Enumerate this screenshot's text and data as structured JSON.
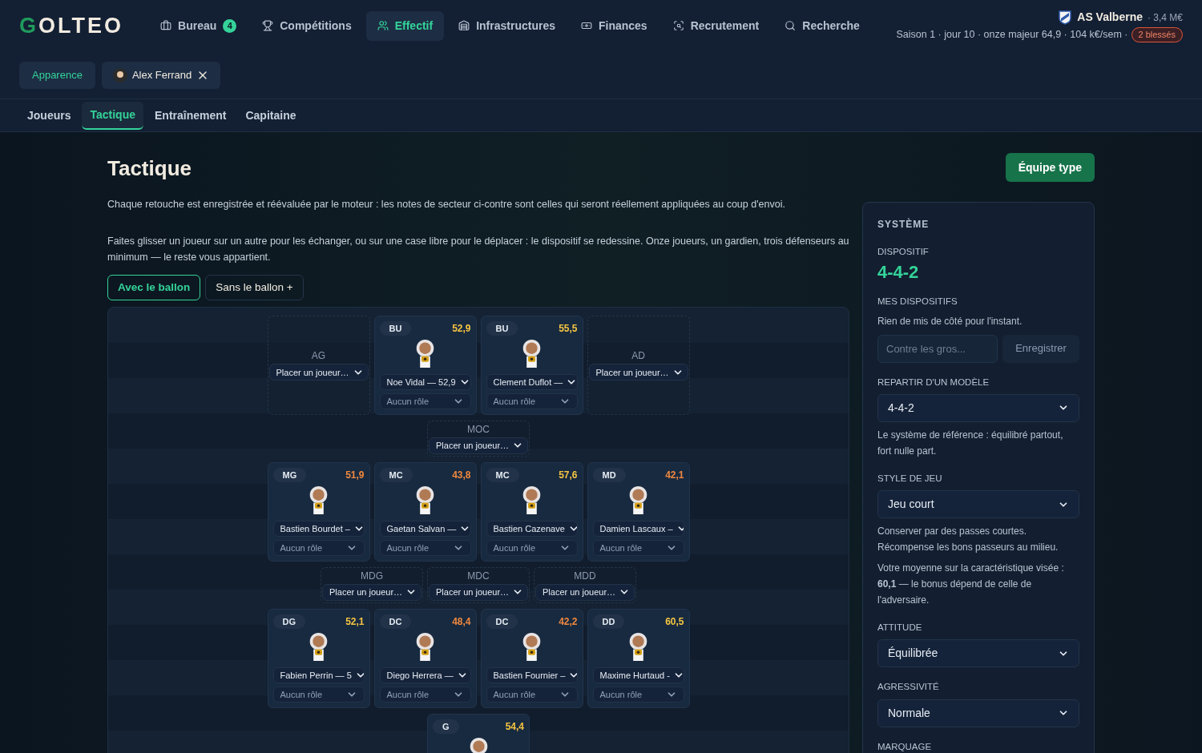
{
  "header": {
    "logo": {
      "accent": "G",
      "rest": "OLTEO"
    },
    "nav": [
      {
        "label": "Bureau",
        "badge": "4",
        "selected": false
      },
      {
        "label": "Compétitions",
        "selected": false
      },
      {
        "label": "Effectif",
        "selected": true
      },
      {
        "label": "Infrastructures",
        "selected": false
      },
      {
        "label": "Finances",
        "selected": false
      },
      {
        "label": "Recrutement",
        "selected": false
      },
      {
        "label": "Recherche",
        "selected": false
      }
    ],
    "club": {
      "name": "AS Valberne",
      "budget": "· 3,4 M€"
    },
    "status": "Saison 1 · jour 10 · onze majeur 64,9 · 104 k€/sem ·",
    "injuries": "2 blessés"
  },
  "chips": [
    {
      "kind": "link",
      "label": "Apparence"
    },
    {
      "kind": "manager",
      "label": "Alex Ferrand"
    }
  ],
  "subtabs": [
    {
      "label": "Joueurs",
      "selected": false
    },
    {
      "label": "Tactique",
      "selected": true
    },
    {
      "label": "Entraînement",
      "selected": false
    },
    {
      "label": "Capitaine",
      "selected": false
    }
  ],
  "page": {
    "title": "Tactique",
    "action": "Équipe type",
    "intro": "Chaque retouche est enregistrée et réévaluée par le moteur : les notes de secteur ci-contre sont celles qui seront réellement appliquées au coup d'envoi.",
    "help": "Faites glisser un joueur sur un autre pour les échanger, ou sur une case libre pour le déplacer : le dispositif se redessine. Onze joueurs, un gardien, trois défenseurs au minimum — le reste vous appartient.",
    "phases": [
      {
        "label": "Avec le ballon",
        "selected": true
      },
      {
        "label": "Sans le ballon +",
        "selected": false
      }
    ]
  },
  "pitch": {
    "rows": [
      {
        "slots": [
          {
            "kind": "empty",
            "label": "AG",
            "value": "Placer un joueur…"
          },
          {
            "kind": "player",
            "position": "BU",
            "rating": "52,9",
            "color": "#f5c542",
            "name": "Noe Vidal — 52,9",
            "role": "Aucun rôle"
          },
          {
            "kind": "player",
            "position": "BU",
            "rating": "55,5",
            "color": "#f5c542",
            "name": "Clement Duflot —",
            "role": "Aucun rôle"
          },
          {
            "kind": "empty",
            "label": "AD",
            "value": "Placer un joueur…"
          }
        ]
      },
      {
        "slots": [
          {
            "kind": "empty",
            "label": "MOC",
            "value": "Placer un joueur…"
          }
        ]
      },
      {
        "slots": [
          {
            "kind": "player",
            "position": "MG",
            "rating": "51,9",
            "color": "#f0883e",
            "name": "Bastien Bourdet –",
            "role": "Aucun rôle"
          },
          {
            "kind": "player",
            "position": "MC",
            "rating": "43,8",
            "color": "#f0883e",
            "name": "Gaetan Salvan —",
            "role": "Aucun rôle"
          },
          {
            "kind": "player",
            "position": "MC",
            "rating": "57,6",
            "color": "#f5c542",
            "name": "Bastien Cazenave",
            "role": "Aucun rôle"
          },
          {
            "kind": "player",
            "position": "MD",
            "rating": "42,1",
            "color": "#f0883e",
            "name": "Damien Lascaux –",
            "role": "Aucun rôle"
          }
        ]
      },
      {
        "slots": [
          {
            "kind": "empty",
            "label": "MDG",
            "value": "Placer un joueur…"
          },
          {
            "kind": "empty",
            "label": "MDC",
            "value": "Placer un joueur…"
          },
          {
            "kind": "empty",
            "label": "MDD",
            "value": "Placer un joueur…"
          }
        ]
      },
      {
        "slots": [
          {
            "kind": "player",
            "position": "DG",
            "rating": "52,1",
            "color": "#f5c542",
            "name": "Fabien Perrin — 5",
            "role": "Aucun rôle"
          },
          {
            "kind": "player",
            "position": "DC",
            "rating": "48,4",
            "color": "#f0883e",
            "name": "Diego Herrera —",
            "role": "Aucun rôle"
          },
          {
            "kind": "player",
            "position": "DC",
            "rating": "42,2",
            "color": "#f0883e",
            "name": "Bastien Fournier –",
            "role": "Aucun rôle"
          },
          {
            "kind": "player",
            "position": "DD",
            "rating": "60,5",
            "color": "#f5c542",
            "name": "Maxime Hurtaud -",
            "role": "Aucun rôle"
          }
        ]
      },
      {
        "slots": [
          {
            "kind": "player",
            "position": "G",
            "rating": "54,4",
            "color": "#f5c542"
          }
        ]
      }
    ]
  },
  "sidebar": {
    "title": "SYSTÈME",
    "sections": [
      {
        "kind": "value",
        "label": "DISPOSITIF",
        "value": "4-4-2"
      },
      {
        "kind": "saved",
        "label": "MES DISPOSITIFS",
        "text": "Rien de mis de côté pour l'instant.",
        "placeholder": "Contre les gros...",
        "button": "Enregistrer"
      },
      {
        "kind": "select",
        "label": "REPARTIR D'UN MODÈLE",
        "value": "4-4-2",
        "notes": [
          "Le système de référence : équilibré partout, fort nulle part."
        ]
      },
      {
        "kind": "select",
        "label": "STYLE DE JEU",
        "value": "Jeu court",
        "notes": [
          "Conserver par des passes courtes. Récompense les bons passeurs au milieu.",
          "Votre moyenne sur la caractéristique visée : **60,1** — le bonus dépend de celle de l'adversaire."
        ]
      },
      {
        "kind": "select",
        "label": "ATTITUDE",
        "value": "Équilibrée"
      },
      {
        "kind": "select",
        "label": "AGRESSIVITÉ",
        "value": "Normale"
      },
      {
        "kind": "label",
        "label": "MARQUAGE"
      }
    ]
  }
}
